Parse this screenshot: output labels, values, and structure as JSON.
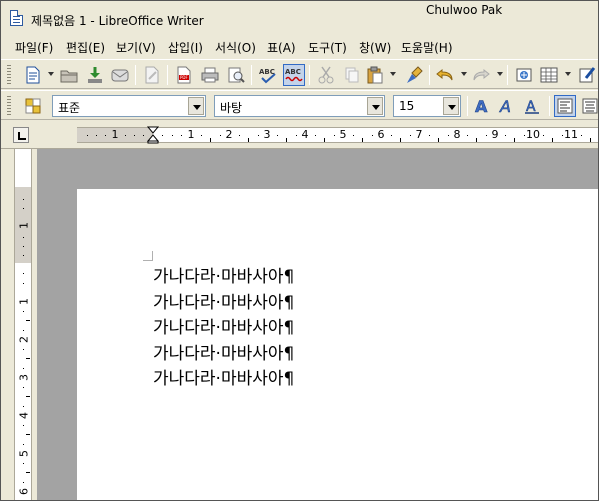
{
  "window": {
    "title": "제목없음 1 - LibreOffice Writer",
    "user": "Chulwoo Pak"
  },
  "menu": [
    "파일(F)",
    "편집(E)",
    "보기(V)",
    "삽입(I)",
    "서식(O)",
    "표(A)",
    "도구(T)",
    "창(W)",
    "도움말(H)"
  ],
  "formatting": {
    "style": "표준",
    "font": "바탕",
    "size": "15"
  },
  "ruler": {
    "h_numbers": [
      "1",
      "1",
      "2",
      "3",
      "4",
      "5",
      "6",
      "7",
      "8",
      "9",
      "10",
      "11"
    ],
    "v_numbers": [
      "1",
      "1",
      "2",
      "3",
      "4",
      "5",
      "6"
    ]
  },
  "document": {
    "lines": [
      "가나다라·마바사아¶",
      "가나다라·마바사아¶",
      "가나다라·마바사아¶",
      "가나다라·마바사아¶",
      "가나다라·마바사아¶"
    ]
  },
  "icons": [
    "new-document-icon",
    "open-icon",
    "save-icon",
    "email-icon",
    "edit-icon",
    "export-pdf-icon",
    "print-icon",
    "print-preview-icon",
    "spellcheck-icon",
    "autospellcheck-icon",
    "cut-icon",
    "copy-icon",
    "paste-icon",
    "clone-format-icon",
    "undo-icon",
    "redo-icon",
    "navigator-icon",
    "table-icon",
    "draw-icon",
    "bold-icon",
    "italic-icon",
    "underline-icon",
    "align-left-icon"
  ]
}
